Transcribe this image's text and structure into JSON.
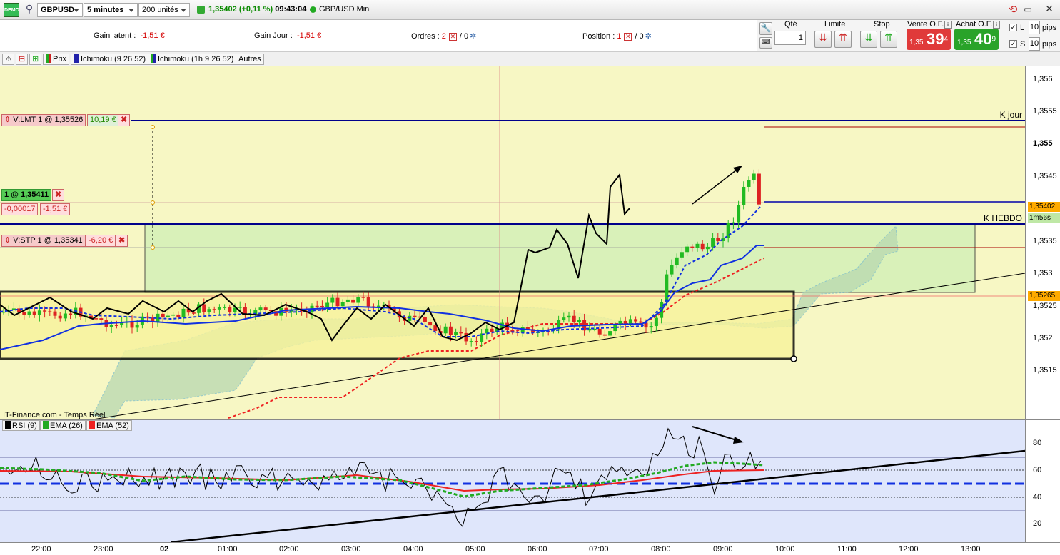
{
  "toolbar": {
    "demo_label": "DEMO",
    "symbol": "GBPUSD",
    "timeframe": "5 minutes",
    "units": "200 unités",
    "price": "1,35402",
    "change": "(+0,11 %)",
    "time": "09:43:04",
    "instrument": "GBP/USD Mini"
  },
  "order_bar": {
    "gain_latent_label": "Gain latent :",
    "gain_latent_value": "-1,51 €",
    "gain_jour_label": "Gain Jour :",
    "gain_jour_value": "-1,51 €",
    "ordres_label": "Ordres :",
    "ordres_count": "2",
    "ordres_zero": "/ 0",
    "position_label": "Position :",
    "position_count": "1",
    "position_zero": "/ 0"
  },
  "trade_box": {
    "qty_label": "Qté",
    "qty_value": "1",
    "limit_label": "Limite",
    "stop_label": "Stop",
    "sell_label": "Vente O.F.",
    "buy_label": "Achat O.F.",
    "sell_small": "1,35",
    "sell_big": "39",
    "sell_sup": "4",
    "buy_small": "1,35",
    "buy_big": "40",
    "buy_sup": "9",
    "l_label": "L",
    "s_label": "S",
    "l_pips": "10",
    "s_pips": "10",
    "pips_label": "pips",
    "sell_color": "#e03a3a",
    "buy_color": "#29a329"
  },
  "indicator_bar": {
    "prix": "Prix",
    "ichimoku1": "Ichimoku (9 26 52)",
    "ichimoku2": "Ichimoku (1h 9 26 52)",
    "autres": "Autres"
  },
  "price_axis": {
    "ticks": [
      "1,356",
      "1,3555",
      "1,355",
      "1,3545",
      "1,354",
      "1,3535",
      "1,353",
      "1,3525",
      "1,352",
      "1,3515"
    ],
    "current_price": "1,35402",
    "countdown": "1m56s",
    "marker_price": "1,35265"
  },
  "orders": {
    "limit_tag": "V:LMT 1 @ 1,35526",
    "limit_gain": "10,19 €",
    "position_tag": "1 @ 1,35411",
    "position_diff": "-0,00017",
    "position_gain": "-1,51 €",
    "stop_tag": "V:STP 1 @ 1,35341",
    "stop_gain": "-6,20 €"
  },
  "labels": {
    "k_jour": "K jour",
    "k_hebdo": "K HEBDO",
    "source": "IT-Finance.com - Temps Réel"
  },
  "rsi_panel": {
    "rsi": "RSI (9)",
    "ema26": "EMA (26)",
    "ema52": "EMA (52)",
    "ticks": [
      "80",
      "60",
      "40",
      "20"
    ]
  },
  "x_axis": [
    "22:00",
    "23:00",
    "02",
    "01:00",
    "02:00",
    "03:00",
    "04:00",
    "05:00",
    "06:00",
    "07:00",
    "08:00",
    "09:00",
    "10:00",
    "11:00",
    "12:00",
    "13:00"
  ]
}
